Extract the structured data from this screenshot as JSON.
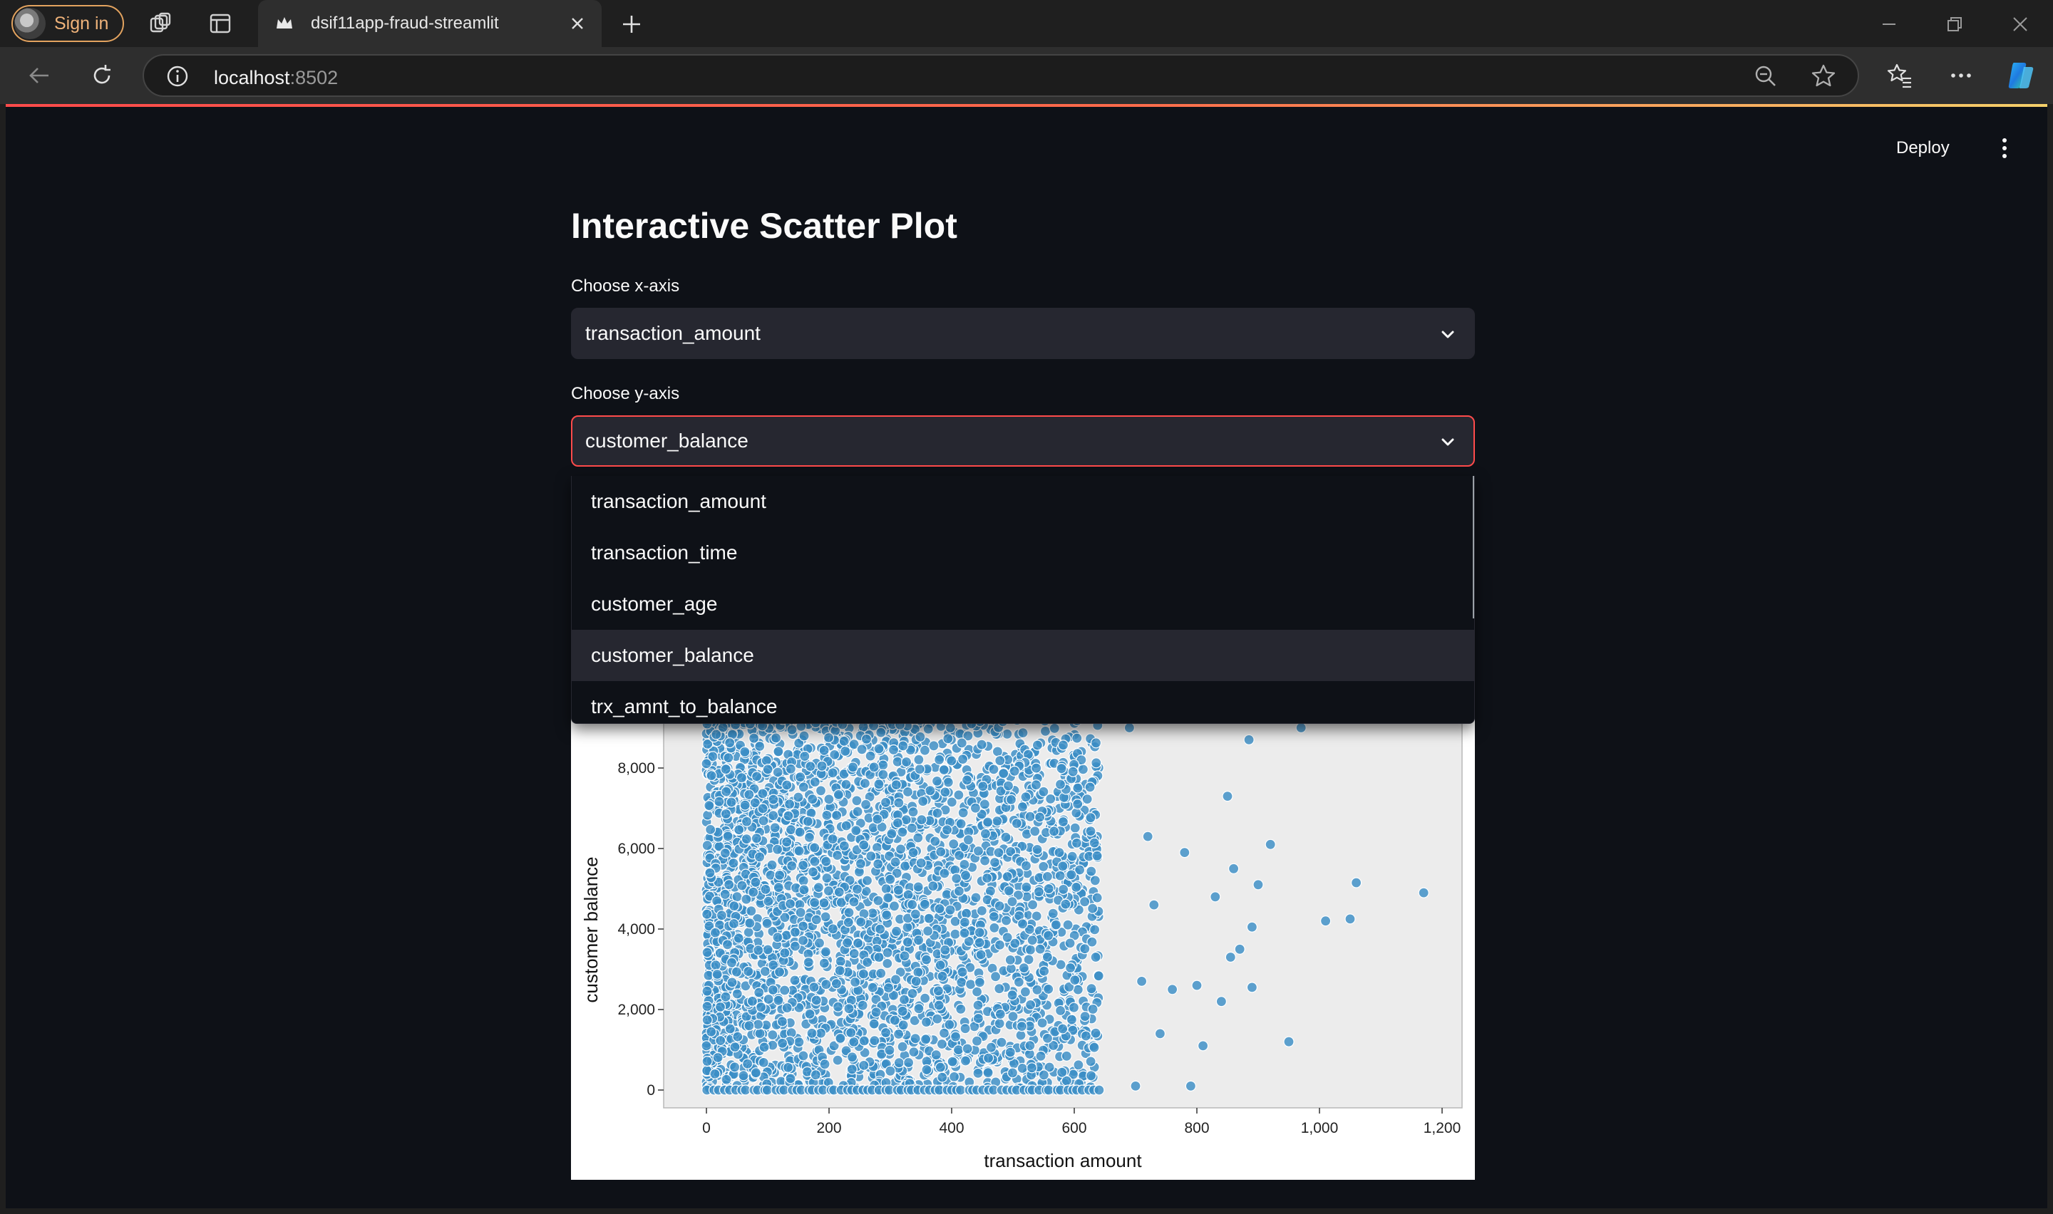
{
  "browser": {
    "profile_label": "Sign in",
    "tab_title": "dsif11app-fraud-streamlit",
    "url_host": "localhost",
    "url_port": ":8502"
  },
  "app": {
    "deploy_label": "Deploy",
    "title": "Interactive Scatter Plot",
    "x_select": {
      "label": "Choose x-axis",
      "value": "transaction_amount"
    },
    "y_select": {
      "label": "Choose y-axis",
      "value": "customer_balance"
    },
    "dropdown_options": [
      "transaction_amount",
      "transaction_time",
      "customer_age",
      "customer_balance",
      "trx_amnt_to_balance"
    ],
    "dropdown_selected_index": 3
  },
  "chart_data": {
    "type": "scatter",
    "xlabel": "transaction amount",
    "ylabel": "customer balance",
    "x_ticks": [
      "0",
      "200",
      "400",
      "600",
      "800",
      "1,000",
      "1,200"
    ],
    "y_ticks": [
      "0",
      "2,000",
      "4,000",
      "6,000",
      "8,000"
    ],
    "xlim": [
      -25,
      1220
    ],
    "point_color": "#3a8ec6",
    "outlier_points": [
      {
        "x": 1170,
        "y": 4900
      },
      {
        "x": 1060,
        "y": 5150
      },
      {
        "x": 1050,
        "y": 4250
      },
      {
        "x": 1010,
        "y": 4200
      },
      {
        "x": 970,
        "y": 9000
      },
      {
        "x": 950,
        "y": 1200
      },
      {
        "x": 920,
        "y": 6100
      },
      {
        "x": 900,
        "y": 5100
      },
      {
        "x": 890,
        "y": 4050
      },
      {
        "x": 890,
        "y": 2550
      },
      {
        "x": 885,
        "y": 8700
      },
      {
        "x": 870,
        "y": 3500
      },
      {
        "x": 860,
        "y": 5500
      },
      {
        "x": 855,
        "y": 3300
      },
      {
        "x": 850,
        "y": 7300
      },
      {
        "x": 840,
        "y": 2200
      },
      {
        "x": 830,
        "y": 4800
      },
      {
        "x": 810,
        "y": 1100
      },
      {
        "x": 800,
        "y": 2600
      },
      {
        "x": 790,
        "y": 100
      },
      {
        "x": 780,
        "y": 5900
      },
      {
        "x": 760,
        "y": 2500
      },
      {
        "x": 740,
        "y": 1400
      },
      {
        "x": 730,
        "y": 4600
      },
      {
        "x": 720,
        "y": 6300
      },
      {
        "x": 710,
        "y": 2700
      },
      {
        "x": 700,
        "y": 100
      },
      {
        "x": 690,
        "y": 9000
      }
    ]
  }
}
